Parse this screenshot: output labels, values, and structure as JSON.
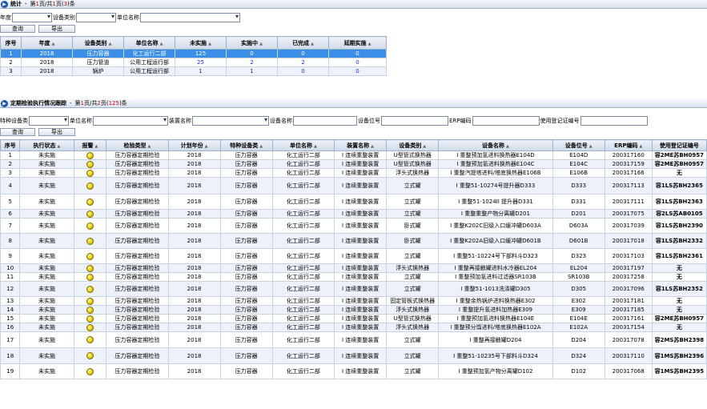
{
  "stats_panel": {
    "title": "统计",
    "pager": {
      "prefix": "第",
      "page": "1",
      "mid": "页/共",
      "total": "1",
      "suffix1": "页(",
      "count": "3",
      "suffix2": ")条"
    }
  },
  "stats_filter": {
    "year_label": "年度",
    "category_label": "设备类别",
    "unit_label": "单位名称",
    "query_button": "查询",
    "export_button": "导出"
  },
  "stats_table": {
    "headers": [
      "序号",
      "年度",
      "设备类别",
      "单位名称",
      "未实施",
      "实施中",
      "已完成",
      "延期实施"
    ],
    "rows": [
      [
        "1",
        "2018",
        "压力容器",
        "化工运行二部",
        "125",
        "0",
        "0",
        "0"
      ],
      [
        "2",
        "2018",
        "压力管道",
        "公用工程运行部",
        "25",
        "2",
        "2",
        "0"
      ],
      [
        "3",
        "2018",
        "锅炉",
        "公用工程运行部",
        "1",
        "1",
        "0",
        "0"
      ]
    ]
  },
  "track_panel": {
    "title": "定期检验执行情况跟踪",
    "pager": {
      "prefix": "第",
      "page": "1",
      "mid": "页/共",
      "total": "2",
      "suffix1": "页(",
      "count": "125",
      "suffix2": ")条"
    }
  },
  "track_filter": {
    "type_label": "特种设备类",
    "unit_label": "单位名称",
    "device_label": "装置名称",
    "equipment_label": "设备名称",
    "position_label": "设备位号",
    "erp_label": "ERP编码",
    "cert_label": "使用登记证编号",
    "query_button": "查询",
    "export_button": "导出"
  },
  "track_table": {
    "headers": [
      "序号",
      "执行状态",
      "报警",
      "检验类型",
      "计划年份",
      "特种设备类",
      "单位名称",
      "装置名称",
      "设备类别",
      "设备名称",
      "设备位号",
      "ERP编码",
      "使用登记证编号"
    ],
    "rows": [
      [
        "1",
        "未实施",
        "",
        "压力容器定期检验",
        "2018",
        "压力容器",
        "化工运行二部",
        "I 连续重整装置",
        "U型管式换热器",
        "I 重整预加氢进料换热器E104D",
        "E104D",
        "200317160",
        "容2ME苏BH0957"
      ],
      [
        "2",
        "未实施",
        "",
        "压力容器定期检验",
        "2018",
        "压力容器",
        "化工运行二部",
        "I 连续重整装置",
        "U型管式换热器",
        "I 重整预加氢进料换热器E104C",
        "E104C",
        "200317159",
        "容2ME苏BH0957"
      ],
      [
        "3",
        "未实施",
        "",
        "压力容器定期检验",
        "2018",
        "压力容器",
        "化工运行二部",
        "I 连续重整装置",
        "浮头式换热器",
        "I 重整汽提塔进料/塔底换热器E106B",
        "E106B",
        "200317166",
        "无"
      ],
      [
        "4",
        "未实施",
        "",
        "压力容器定期检验",
        "2018",
        "压力容器",
        "化工运行二部",
        "I 连续重整装置",
        "立式罐",
        "I 重整51-10274号提升器D333",
        "D333",
        "200317113",
        "容1LS苏BH2365"
      ],
      [
        "5",
        "未实施",
        "",
        "压力容器定期检验",
        "2018",
        "压力容器",
        "化工运行二部",
        "I 连续重整装置",
        "立式罐",
        "I 重整51-1024II 提升器D331",
        "D331",
        "200317111",
        "容1LS苏BH2363"
      ],
      [
        "6",
        "未实施",
        "",
        "压力容器定期检验",
        "2018",
        "压力容器",
        "化工运行二部",
        "I 连续重整装置",
        "立式罐",
        "I 重整重整产物分离罐D201",
        "D201",
        "200317075",
        "容2LS苏AB0105"
      ],
      [
        "7",
        "未实施",
        "",
        "压力容器定期检验",
        "2018",
        "压力容器",
        "化工运行二部",
        "I 连续重整装置",
        "卧式罐",
        "I 重整K202C旧级入口缓冲罐D603A",
        "D603A",
        "200317039",
        "容1LS苏BH2390"
      ],
      [
        "8",
        "未实施",
        "",
        "压力容器定期检验",
        "2018",
        "压力容器",
        "化工运行二部",
        "I 连续重整装置",
        "卧式罐",
        "I 重整K202A旧级入口缓冲罐D601B",
        "D601B",
        "200317018",
        "容1LS苏BH2332"
      ],
      [
        "9",
        "未实施",
        "",
        "压力容器定期检验",
        "2018",
        "压力容器",
        "化工运行二部",
        "I 连续重整装置",
        "立式罐",
        "I 重整51-10224号下部料斗D323",
        "D323",
        "200317103",
        "容1LS苏BH2361"
      ],
      [
        "10",
        "未实施",
        "",
        "压力容器定期检验",
        "2018",
        "压力容器",
        "化工运行二部",
        "I 连续重整装置",
        "浮头式换热器",
        "I 重整再接触罐进料水冷器EL204",
        "EL204",
        "200317197",
        "无"
      ],
      [
        "11",
        "未实施",
        "",
        "压力容器定期检验",
        "2018",
        "压力容器",
        "化工运行二部",
        "I 连续重整装置",
        "立式罐",
        "I 重整预加氢进料过滤器SR103B",
        "SR103B",
        "200317258",
        "无"
      ],
      [
        "12",
        "未实施",
        "",
        "压力容器定期检验",
        "2018",
        "压力容器",
        "化工运行二部",
        "I 连续重整装置",
        "立式罐",
        "I 重整51-1013洗涤罐D305",
        "D305",
        "200317096",
        "容1LS苏BH2352"
      ],
      [
        "13",
        "未实施",
        "",
        "压力容器定期检验",
        "2018",
        "压力容器",
        "化工运行二部",
        "I 连续重整装置",
        "固定管板式换热器",
        "I 重整余热锅炉进料换热器E302",
        "E302",
        "200317181",
        "无"
      ],
      [
        "14",
        "未实施",
        "",
        "压力容器定期检验",
        "2018",
        "压力容器",
        "化工运行二部",
        "I 连续重整装置",
        "浮头式换热器",
        "I 重整提升氢进料加热器E309",
        "E309",
        "200317185",
        "无"
      ],
      [
        "15",
        "未实施",
        "",
        "压力容器定期检验",
        "2018",
        "压力容器",
        "化工运行二部",
        "I 连续重整装置",
        "U型管式换热器",
        "I 重整预加氢进料换热器E104E",
        "E104E",
        "200317161",
        "容2ME苏BH0957"
      ],
      [
        "16",
        "未实施",
        "",
        "压力容器定期检验",
        "2018",
        "压力容器",
        "化工运行二部",
        "I 连续重整装置",
        "浮头式换热器",
        "I 重整预分馏进料/塔底换热器E102A",
        "E102A",
        "200317154",
        "无"
      ],
      [
        "17",
        "未实施",
        "",
        "压力容器定期检验",
        "2018",
        "压力容器",
        "化工运行二部",
        "I 连续重整装置",
        "立式罐",
        "I 重整再接触罐D204",
        "D204",
        "200317078",
        "容2MS苏BH2398"
      ],
      [
        "18",
        "未实施",
        "",
        "压力容器定期检验",
        "2018",
        "压力容器",
        "化工运行二部",
        "I 连续重整装置",
        "立式罐",
        "I 重整51-10235号下部料斗D324",
        "D324",
        "200317110",
        "容1MS苏BH2396"
      ],
      [
        "19",
        "未实施",
        "",
        "压力容器定期检验",
        "2018",
        "压力容器",
        "化工运行二部",
        "I 连续重整装置",
        "立式罐",
        "I 重整预加氢产物分离罐D102",
        "D102",
        "200317068",
        "容1MS苏BH2395"
      ]
    ]
  }
}
